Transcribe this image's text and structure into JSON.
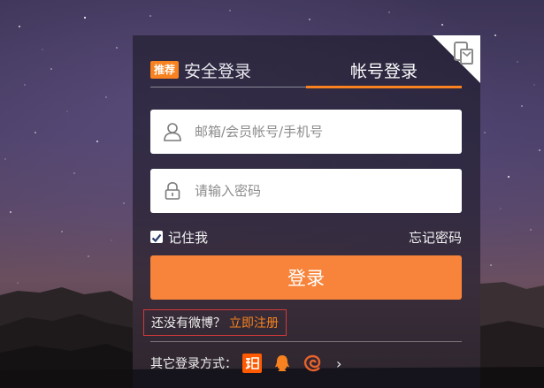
{
  "tabs": {
    "badge": "推荐",
    "secure_login": "安全登录",
    "account_login": "帐号登录"
  },
  "form": {
    "username_placeholder": "邮箱/会员帐号/手机号",
    "username_value": "",
    "password_placeholder": "请输入密码",
    "password_value": "",
    "remember_label": "记住我",
    "remember_checked": true,
    "forgot_label": "忘记密码",
    "login_label": "登录"
  },
  "register": {
    "prompt": "还没有微博？",
    "link": "立即注册"
  },
  "other_login": {
    "label": "其它登录方式：",
    "providers": [
      "taobao-icon",
      "qq-icon",
      "alipay-icon"
    ],
    "more": "›"
  },
  "colors": {
    "accent": "#f7821f",
    "button": "#f7843a",
    "register_border": "#d23a3a"
  }
}
